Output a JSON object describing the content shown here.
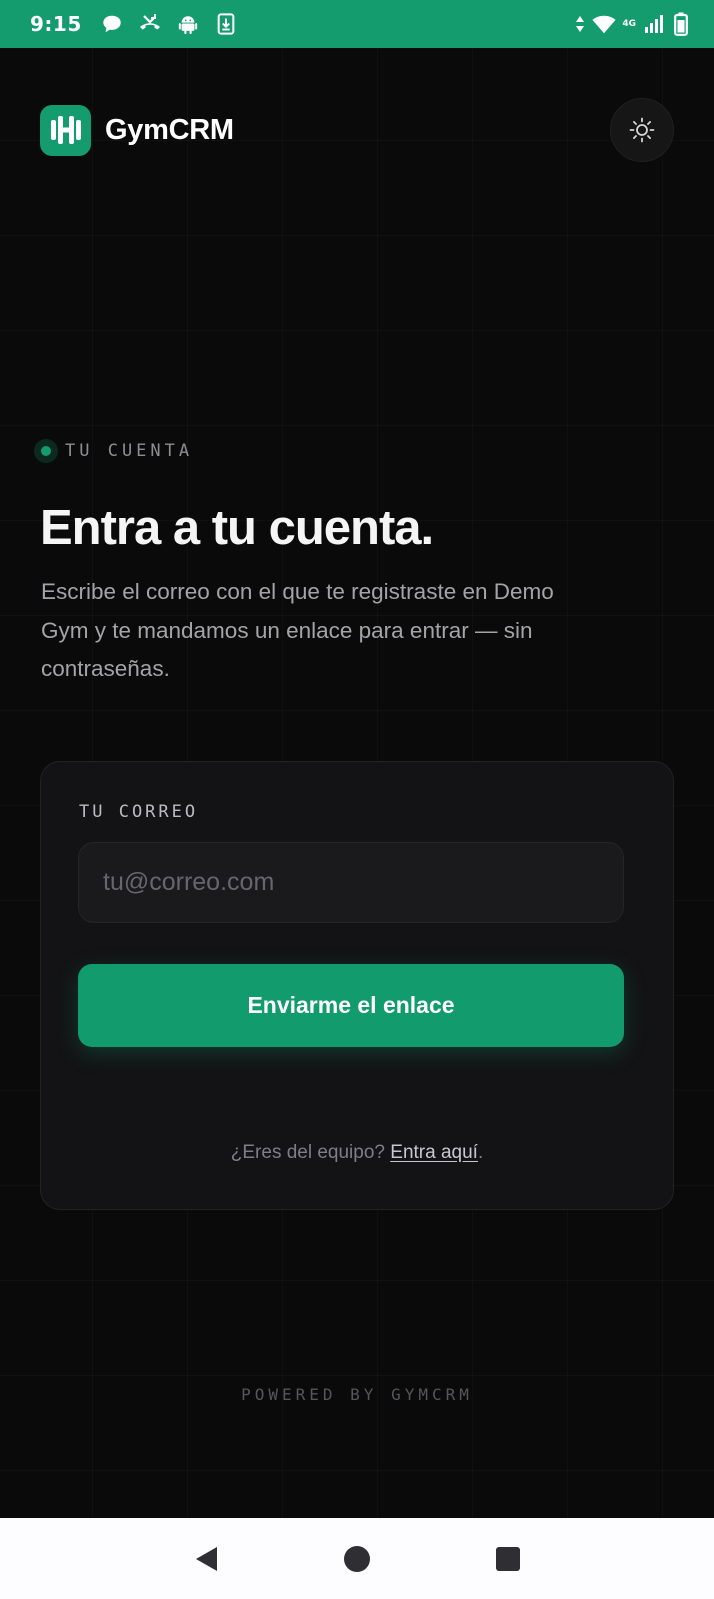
{
  "status_bar": {
    "time": "9:15",
    "network": "4G",
    "left_icons": [
      "chat-icon",
      "missed-call-icon",
      "android-icon",
      "download-icon"
    ],
    "right_icons": [
      "data-arrows-icon",
      "wifi-icon",
      "signal-icon",
      "battery-icon"
    ],
    "background": "#159c6e"
  },
  "header": {
    "brand": "GymCRM",
    "logo_icon": "dumbbell-icon",
    "theme_toggle_icon": "sun-icon",
    "brand_color": "#159c6e"
  },
  "hero": {
    "eyebrow": "TU CUENTA",
    "title": "Entra a tu cuenta.",
    "description": "Escribe el correo con el que te registraste en Demo Gym y te mandamos un enlace para entrar — sin contraseñas."
  },
  "login_form": {
    "email_label": "TU CORREO",
    "email_value": "",
    "email_placeholder": "tu@correo.com",
    "submit_label": "Enviarme el enlace",
    "staff_prompt": "¿Eres del equipo?",
    "staff_link": "Entra aquí",
    "staff_suffix": "."
  },
  "footer": {
    "powered_by": "POWERED BY GYMCRM"
  },
  "nav_bar": {
    "buttons": [
      "back-icon",
      "home-icon",
      "recents-icon"
    ]
  }
}
